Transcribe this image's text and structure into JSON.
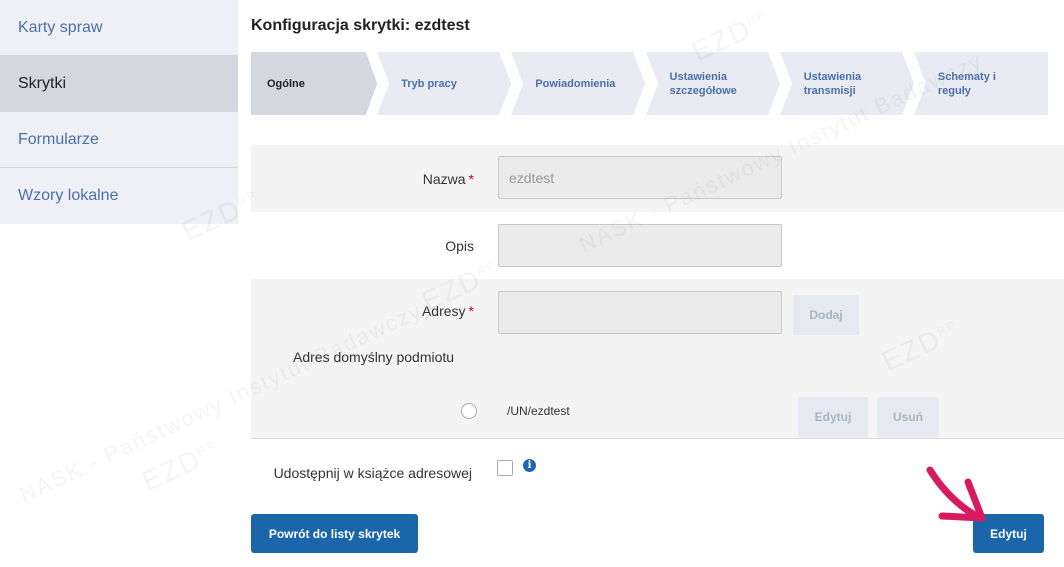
{
  "sidebar": {
    "items": [
      {
        "label": "Karty spraw"
      },
      {
        "label": "Skrytki"
      },
      {
        "label": "Formularze"
      },
      {
        "label": "Wzory lokalne"
      }
    ]
  },
  "page": {
    "title": "Konfiguracja skrytki: ezdtest"
  },
  "steps": [
    {
      "label": "Ogólne"
    },
    {
      "label": "Tryb pracy"
    },
    {
      "label": "Powiadomienia"
    },
    {
      "label_line1": "Ustawienia",
      "label_line2": "szczegółowe"
    },
    {
      "label_line1": "Ustawienia",
      "label_line2": "transmisji"
    },
    {
      "label_line1": "Schematy i",
      "label_line2": "reguły"
    }
  ],
  "form": {
    "name": {
      "label": "Nazwa",
      "required": "*",
      "value": "ezdtest"
    },
    "description": {
      "label": "Opis",
      "value": ""
    },
    "addresses": {
      "label": "Adresy",
      "required": "*",
      "value": "",
      "add_label": "Dodaj",
      "default_address_label": "Adres domyślny podmiotu",
      "entry": "/UN/ezdtest",
      "edit_label": "Edytuj",
      "delete_label": "Usuń"
    },
    "share": {
      "label": "Udostępnij w książce adresowej",
      "info_icon": "i"
    }
  },
  "actions": {
    "back_label": "Powrót do listy skrytek",
    "edit_label": "Edytuj"
  },
  "watermark": {
    "text1": "EZD",
    "text2": "RP",
    "text3": "NASK - Państwowy Instytut Badawczy"
  },
  "colors": {
    "primary": "#1b66ab",
    "accent_arrow": "#d81b60",
    "sidebar_bg": "#eef0f5",
    "sidebar_active": "#d4d7de",
    "link": "#4d6fa8"
  }
}
